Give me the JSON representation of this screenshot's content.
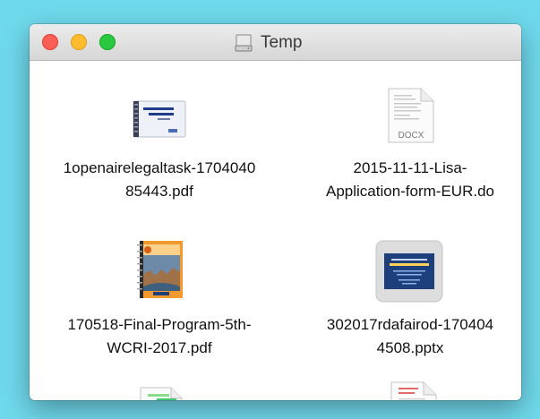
{
  "window": {
    "title": "Temp"
  },
  "files": [
    {
      "name_line1": "1openairelegaltask-1704040",
      "name_line2": "85443.pdf",
      "icon": "pdf-document-icon"
    },
    {
      "name_line1": "2015-11-11-Lisa-",
      "name_line2": "Application-form-EUR.do",
      "icon": "docx-document-icon",
      "badge": "DOCX"
    },
    {
      "name_line1": "170518-Final-Program-5th-",
      "name_line2": "WCRI-2017.pdf",
      "icon": "pdf-booklet-icon"
    },
    {
      "name_line1": "302017rdafairod-170404",
      "name_line2": "4508.pptx",
      "icon": "pptx-slide-icon"
    },
    {
      "icon": "document-icon"
    },
    {
      "icon": "document-icon"
    }
  ],
  "colors": {
    "desktop": "#6fd9ec",
    "close": "#fc5f57",
    "minimize": "#fdbc2e",
    "zoom": "#29c840"
  }
}
